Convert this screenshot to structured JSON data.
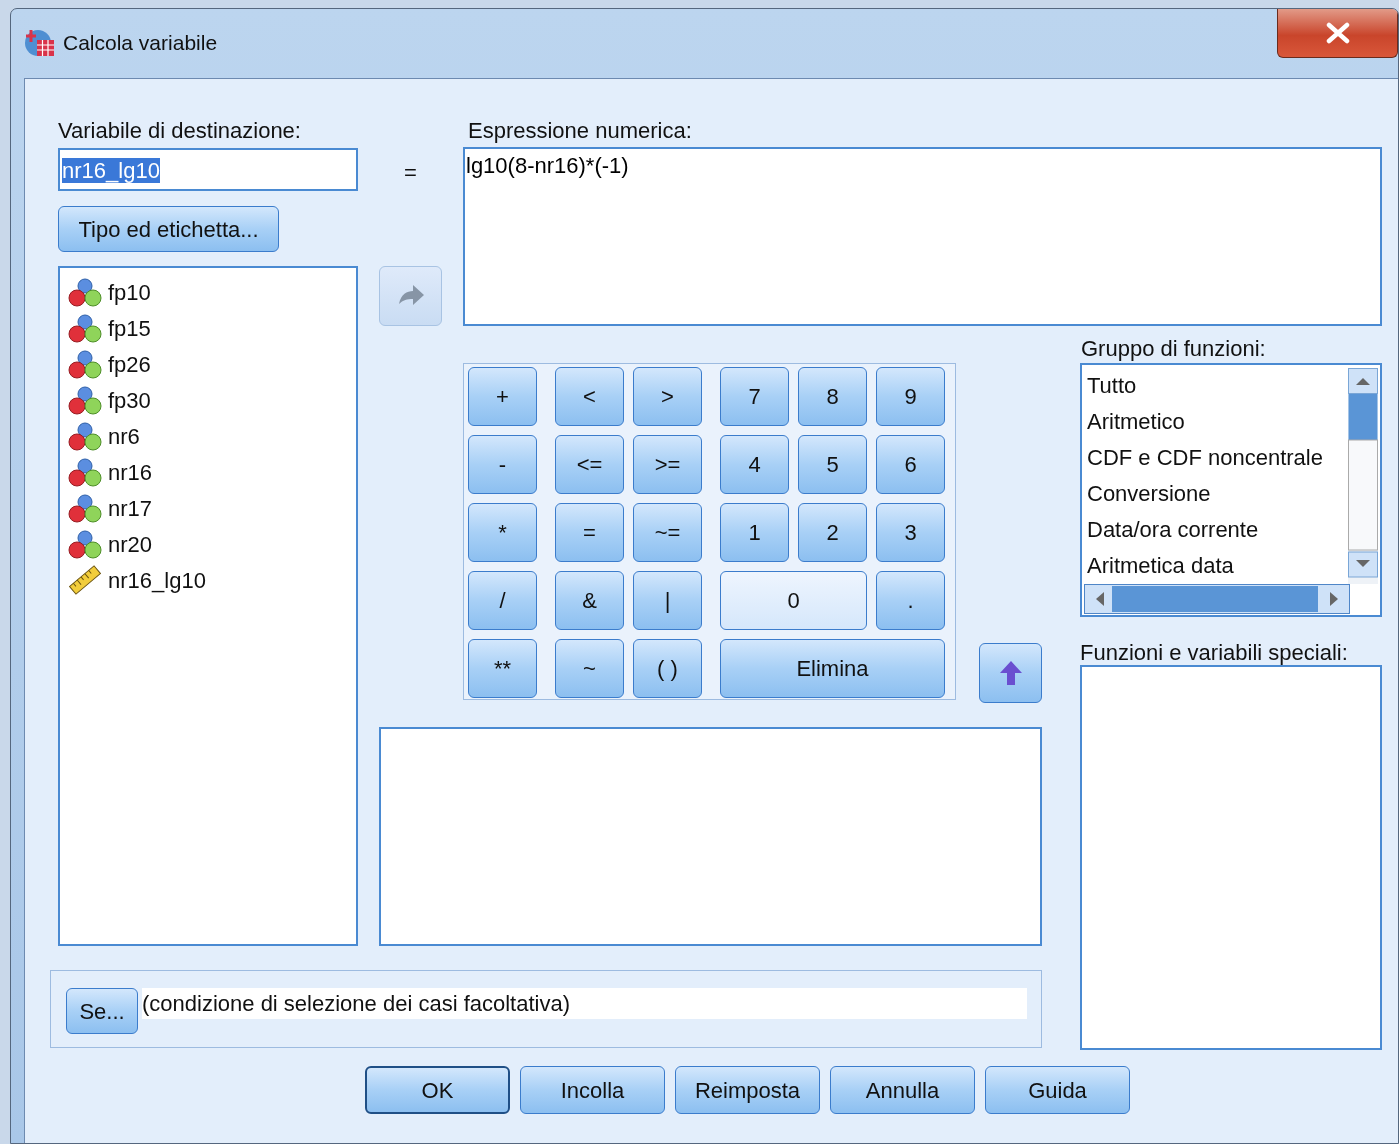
{
  "window": {
    "title": "Calcola variabile"
  },
  "target": {
    "label": "Variabile di destinazione:",
    "value": "nr16_lg10",
    "text_selected": true
  },
  "equals": "=",
  "type_button": {
    "label": "Tipo ed etichetta..."
  },
  "variables": [
    {
      "name": "fp10",
      "kind": "nominal"
    },
    {
      "name": "fp15",
      "kind": "nominal"
    },
    {
      "name": "fp26",
      "kind": "nominal"
    },
    {
      "name": "fp30",
      "kind": "nominal"
    },
    {
      "name": "nr6",
      "kind": "nominal"
    },
    {
      "name": "nr16",
      "kind": "nominal"
    },
    {
      "name": "nr17",
      "kind": "nominal"
    },
    {
      "name": "nr20",
      "kind": "nominal"
    },
    {
      "name": "nr16_lg10",
      "kind": "scale"
    }
  ],
  "transfer_button": {
    "disabled": true
  },
  "expression": {
    "label": "Espressione numerica:",
    "value": "lg10(8-nr16)*(-1)"
  },
  "keypad": {
    "keys": [
      {
        "label": "+",
        "kind": "single",
        "highlighted": false
      },
      {
        "label": "<",
        "kind": "single",
        "highlighted": false
      },
      {
        "label": ">",
        "kind": "single",
        "highlighted": false
      },
      {
        "label": "7",
        "kind": "single",
        "highlighted": false
      },
      {
        "label": "8",
        "kind": "single",
        "highlighted": false
      },
      {
        "label": "9",
        "kind": "single",
        "highlighted": false
      },
      {
        "label": "-",
        "kind": "single",
        "highlighted": false
      },
      {
        "label": "<=",
        "kind": "single",
        "highlighted": false
      },
      {
        "label": ">=",
        "kind": "single",
        "highlighted": false
      },
      {
        "label": "4",
        "kind": "single",
        "highlighted": false
      },
      {
        "label": "5",
        "kind": "single",
        "highlighted": false
      },
      {
        "label": "6",
        "kind": "single",
        "highlighted": false
      },
      {
        "label": "*",
        "kind": "single",
        "highlighted": false
      },
      {
        "label": "=",
        "kind": "single",
        "highlighted": false
      },
      {
        "label": "~=",
        "kind": "single",
        "highlighted": false
      },
      {
        "label": "1",
        "kind": "single",
        "highlighted": false
      },
      {
        "label": "2",
        "kind": "single",
        "highlighted": false
      },
      {
        "label": "3",
        "kind": "single",
        "highlighted": false
      },
      {
        "label": "/",
        "kind": "single",
        "highlighted": false
      },
      {
        "label": "&",
        "kind": "single",
        "highlighted": false
      },
      {
        "label": "|",
        "kind": "single",
        "highlighted": false
      },
      {
        "label": "0",
        "kind": "double",
        "highlighted": true
      },
      {
        "label": ".",
        "kind": "single",
        "highlighted": false
      },
      {
        "label": "**",
        "kind": "single",
        "highlighted": false
      },
      {
        "label": "~",
        "kind": "single",
        "highlighted": false
      },
      {
        "label": "( )",
        "kind": "single",
        "highlighted": false
      },
      {
        "label": "Elimina",
        "kind": "triple",
        "highlighted": false
      }
    ]
  },
  "insert_button": {
    "disabled": false
  },
  "function_groups": {
    "label": "Gruppo di funzioni:",
    "items": [
      "Tutto",
      "Aritmetico",
      "CDF e CDF noncentrale",
      "Conversione",
      "Data/ora corrente",
      "Aritmetica data"
    ]
  },
  "special_functions": {
    "label": "Funzioni e variabili speciali:"
  },
  "if_button": {
    "label": "Se..."
  },
  "condition": "(condizione di selezione dei casi facoltativa)",
  "buttons": [
    {
      "label": "OK",
      "default": true
    },
    {
      "label": "Incolla",
      "default": false
    },
    {
      "label": "Reimposta",
      "default": false
    },
    {
      "label": "Annulla",
      "default": false
    },
    {
      "label": "Guida",
      "default": false
    }
  ]
}
